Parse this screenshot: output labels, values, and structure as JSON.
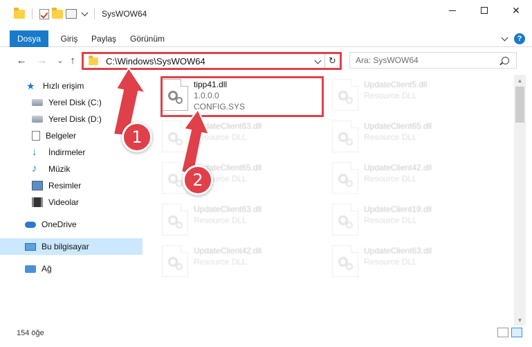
{
  "window": {
    "title": "SysWOW64",
    "minimize": "",
    "maximize": "",
    "close": "✕"
  },
  "ribbon": {
    "tabs": [
      {
        "label": "Dosya"
      },
      {
        "label": "Giriş"
      },
      {
        "label": "Paylaş"
      },
      {
        "label": "Görünüm"
      }
    ],
    "help": "?"
  },
  "nav": {
    "back": "←",
    "forward": "→",
    "recent": "⌄",
    "up": "↑",
    "address": "C:\\Windows\\SysWOW64",
    "refresh": "↻",
    "search_placeholder": "Ara: SysWOW64"
  },
  "sidebar": {
    "items": [
      {
        "label": "Hızlı erişim",
        "icon": "star-icon"
      },
      {
        "label": "Yerel Disk (C:)",
        "icon": "drive-icon"
      },
      {
        "label": "Yerel Disk (D:)",
        "icon": "drive-icon"
      },
      {
        "label": "Belgeler",
        "icon": "documents-icon"
      },
      {
        "label": "İndirmeler",
        "icon": "downloads-icon"
      },
      {
        "label": "Müzik",
        "icon": "music-icon"
      },
      {
        "label": "Resimler",
        "icon": "pictures-icon"
      },
      {
        "label": "Videolar",
        "icon": "videos-icon"
      },
      {
        "label": "OneDrive",
        "icon": "cloud-icon"
      },
      {
        "label": "Bu bilgisayar",
        "icon": "computer-icon"
      },
      {
        "label": "Ağ",
        "icon": "network-icon"
      }
    ]
  },
  "files": {
    "main": {
      "name": "tipp41.dll",
      "version": "1.0.0.0",
      "desc": "CONFIG.SYS"
    },
    "faded": [
      {
        "name": "UpdateClient5.dll",
        "desc": "Resource DLL"
      },
      {
        "name": "UpdateClient63.dll",
        "desc": "Resource DLL"
      },
      {
        "name": "UpdateClient65.dll",
        "desc": "Resource DLL"
      },
      {
        "name": "UpdateClient65.dll",
        "desc": "Resource DLL"
      },
      {
        "name": "UpdateClient42.dll",
        "desc": "Resource DLL"
      },
      {
        "name": "UpdateClient63.dll",
        "desc": "Resource DLL"
      },
      {
        "name": "UpdateClient19.dll",
        "desc": "Resource DLL"
      },
      {
        "name": "UpdateClient42.dll",
        "desc": "Resource DLL"
      },
      {
        "name": "UpdateClient63.dll",
        "desc": "Resource DLL"
      }
    ]
  },
  "status": {
    "count": "154 öğe"
  },
  "callouts": {
    "one": "1",
    "two": "2",
    "color": "#e0404a"
  },
  "colors": {
    "accent": "#1979ca",
    "selection": "#cce8ff",
    "highlight": "#e0404a"
  }
}
